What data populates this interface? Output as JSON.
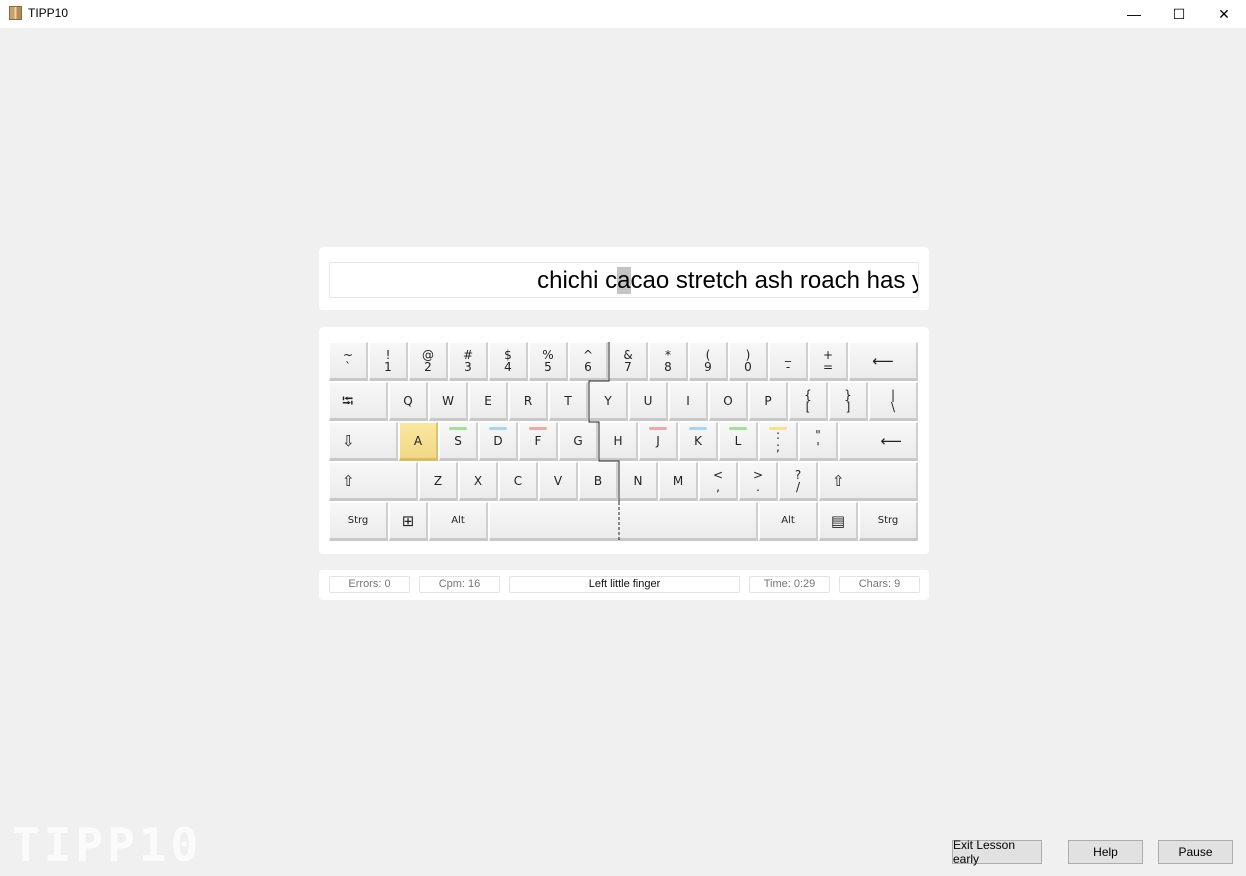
{
  "window": {
    "title": "TIPP10",
    "minimize": "—",
    "maximize": "☐",
    "close": "✕"
  },
  "text": {
    "before": "chichi c",
    "current": "a",
    "after": "cao stretch ash roach has y"
  },
  "keyboard": {
    "rows": [
      [
        {
          "t": "~",
          "b": "`"
        },
        {
          "t": "!",
          "b": "1"
        },
        {
          "t": "@",
          "b": "2"
        },
        {
          "t": "#",
          "b": "3"
        },
        {
          "t": "$",
          "b": "4"
        },
        {
          "t": "%",
          "b": "5"
        },
        {
          "t": "^",
          "b": "6"
        },
        {
          "t": "&",
          "b": "7"
        },
        {
          "t": "*",
          "b": "8"
        },
        {
          "t": "(",
          "b": "9"
        },
        {
          "t": ")",
          "b": "0"
        },
        {
          "t": "_",
          "b": "-"
        },
        {
          "t": "+",
          "b": "="
        },
        {
          "b": "⟵",
          "icon": "backspace-icon"
        }
      ],
      [
        {
          "b": "⭾",
          "icon": "tab-icon"
        },
        {
          "b": "Q"
        },
        {
          "b": "W"
        },
        {
          "b": "E"
        },
        {
          "b": "R"
        },
        {
          "b": "T"
        },
        {
          "b": "Y"
        },
        {
          "b": "U"
        },
        {
          "b": "I"
        },
        {
          "b": "O"
        },
        {
          "b": "P"
        },
        {
          "t": "{",
          "b": "["
        },
        {
          "t": "}",
          "b": "]"
        },
        {
          "t": "|",
          "b": "\\"
        }
      ],
      [
        {
          "b": "⇩",
          "icon": "caps-lock-icon"
        },
        {
          "b": "A",
          "highlight": true
        },
        {
          "b": "S",
          "finger": "#a5de98"
        },
        {
          "b": "D",
          "finger": "#a8d4f2"
        },
        {
          "b": "F",
          "finger": "#f0a7a7"
        },
        {
          "b": "G"
        },
        {
          "b": "H"
        },
        {
          "b": "J",
          "finger": "#f0a7a7"
        },
        {
          "b": "K",
          "finger": "#a8d4f2"
        },
        {
          "b": "L",
          "finger": "#a5de98"
        },
        {
          "t": ":",
          "b": ";",
          "finger": "#f8e08c"
        },
        {
          "t": "\"",
          "b": "'"
        },
        {
          "b": "⟵",
          "icon": "enter-icon"
        }
      ],
      [
        {
          "b": "⇧",
          "icon": "shift-left-icon"
        },
        {
          "b": "Z"
        },
        {
          "b": "X"
        },
        {
          "b": "C"
        },
        {
          "b": "V"
        },
        {
          "b": "B"
        },
        {
          "b": "N"
        },
        {
          "b": "M"
        },
        {
          "t": "<",
          "b": ","
        },
        {
          "t": ">",
          "b": "."
        },
        {
          "t": "?",
          "b": "/"
        },
        {
          "b": "⇧",
          "icon": "shift-right-icon"
        }
      ],
      [
        {
          "b": "Strg"
        },
        {
          "b": "⊞",
          "icon": "windows-icon"
        },
        {
          "b": "Alt"
        },
        {
          "b": ""
        },
        {
          "b": "Alt"
        },
        {
          "b": "▤",
          "icon": "menu-icon"
        },
        {
          "b": "Strg"
        }
      ]
    ]
  },
  "status": {
    "errors": "Errors: 0",
    "cpm": "Cpm: 16",
    "finger": "Left little finger",
    "time": "Time: 0:29",
    "chars": "Chars: 9"
  },
  "buttons": {
    "exit": "Exit Lesson early",
    "help": "Help",
    "pause": "Pause"
  },
  "logo": "TIPP10"
}
